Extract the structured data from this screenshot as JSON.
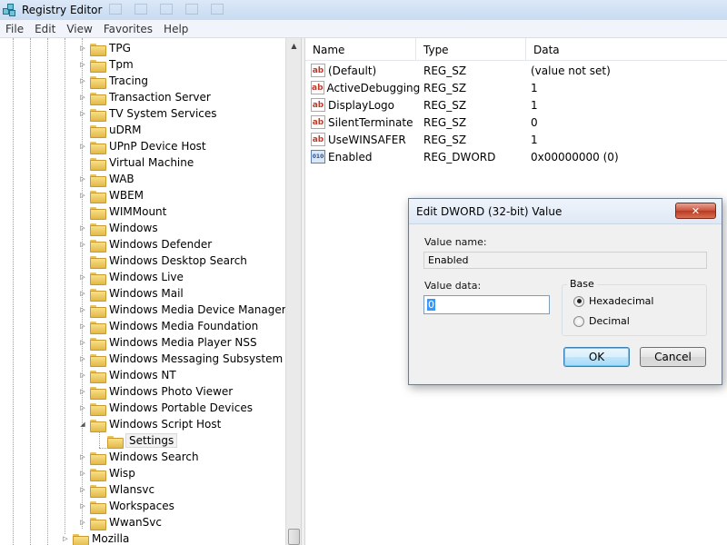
{
  "window": {
    "title": "Registry Editor"
  },
  "menu": [
    "File",
    "Edit",
    "View",
    "Favorites",
    "Help"
  ],
  "tree": {
    "items": [
      {
        "label": "TPG",
        "expander": "▷"
      },
      {
        "label": "Tpm",
        "expander": "▷"
      },
      {
        "label": "Tracing",
        "expander": "▷"
      },
      {
        "label": "Transaction Server",
        "expander": "▷"
      },
      {
        "label": "TV System Services",
        "expander": "▷"
      },
      {
        "label": "uDRM",
        "expander": ""
      },
      {
        "label": "UPnP Device Host",
        "expander": "▷"
      },
      {
        "label": "Virtual Machine",
        "expander": ""
      },
      {
        "label": "WAB",
        "expander": "▷"
      },
      {
        "label": "WBEM",
        "expander": "▷"
      },
      {
        "label": "WIMMount",
        "expander": ""
      },
      {
        "label": "Windows",
        "expander": "▷"
      },
      {
        "label": "Windows Defender",
        "expander": "▷"
      },
      {
        "label": "Windows Desktop Search",
        "expander": ""
      },
      {
        "label": "Windows Live",
        "expander": "▷"
      },
      {
        "label": "Windows Mail",
        "expander": "▷"
      },
      {
        "label": "Windows Media Device Manager",
        "expander": "▷"
      },
      {
        "label": "Windows Media Foundation",
        "expander": "▷"
      },
      {
        "label": "Windows Media Player NSS",
        "expander": "▷"
      },
      {
        "label": "Windows Messaging Subsystem",
        "expander": "▷"
      },
      {
        "label": "Windows NT",
        "expander": "▷"
      },
      {
        "label": "Windows Photo Viewer",
        "expander": "▷"
      },
      {
        "label": "Windows Portable Devices",
        "expander": "▷"
      },
      {
        "label": "Windows Script Host",
        "expander": "◢"
      },
      {
        "label": "Settings",
        "expander": "",
        "child": true,
        "selected": true
      },
      {
        "label": "Windows Search",
        "expander": "▷"
      },
      {
        "label": "Wisp",
        "expander": "▷"
      },
      {
        "label": "Wlansvc",
        "expander": "▷"
      },
      {
        "label": "Workspaces",
        "expander": "▷"
      },
      {
        "label": "WwanSvc",
        "expander": "▷"
      },
      {
        "label": "Mozilla",
        "expander": "▷",
        "level": "parent"
      }
    ]
  },
  "scroll_arrow": "▲",
  "list": {
    "headers": {
      "name": "Name",
      "type": "Type",
      "data": "Data"
    },
    "rows": [
      {
        "icon": "ab",
        "name": "(Default)",
        "type": "REG_SZ",
        "data": "(value not set)"
      },
      {
        "icon": "ab",
        "name": "ActiveDebugging",
        "type": "REG_SZ",
        "data": "1"
      },
      {
        "icon": "ab",
        "name": "DisplayLogo",
        "type": "REG_SZ",
        "data": "1"
      },
      {
        "icon": "ab",
        "name": "SilentTerminate",
        "type": "REG_SZ",
        "data": "0"
      },
      {
        "icon": "ab",
        "name": "UseWINSAFER",
        "type": "REG_SZ",
        "data": "1"
      },
      {
        "icon": "010",
        "name": "Enabled",
        "type": "REG_DWORD",
        "data": "0x00000000 (0)"
      }
    ]
  },
  "dialog": {
    "title": "Edit DWORD (32-bit) Value",
    "close": "✕",
    "value_name_label": "Value name:",
    "value_name": "Enabled",
    "value_data_label": "Value data:",
    "value_data": "0",
    "base_label": "Base",
    "hex_label": "Hexadecimal",
    "dec_label": "Decimal",
    "ok_label": "OK",
    "cancel_label": "Cancel",
    "selected_base": "hexadecimal"
  }
}
